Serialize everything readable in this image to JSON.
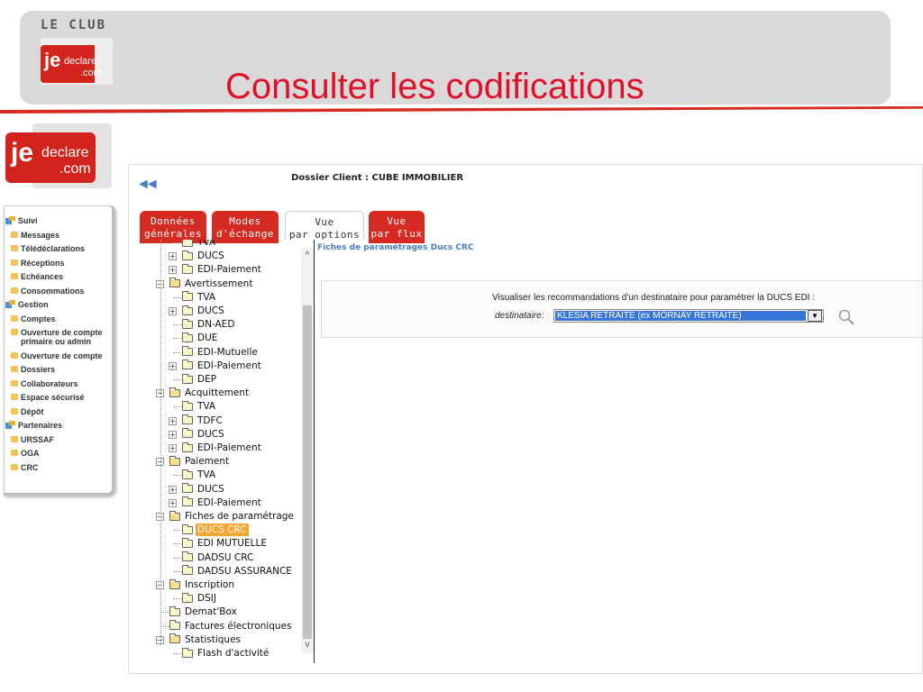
{
  "banner": {
    "club_label": "LE CLUB",
    "logo_je": "je",
    "logo_declare": "declare",
    "logo_com": ".com",
    "title": "Consulter les codifications"
  },
  "side_logo": {
    "je": "je",
    "declare": "declare",
    "com": ".com"
  },
  "menu": {
    "items": [
      {
        "label": "Suivi",
        "type": "head"
      },
      {
        "label": "Messages",
        "type": "sub"
      },
      {
        "label": "Télédéclarations",
        "type": "sub"
      },
      {
        "label": "Réceptions",
        "type": "sub"
      },
      {
        "label": "Echéances",
        "type": "sub"
      },
      {
        "label": "Consommations",
        "type": "sub"
      },
      {
        "label": "Gestion",
        "type": "head"
      },
      {
        "label": "Comptes",
        "type": "sub"
      },
      {
        "label": "Ouverture de compte",
        "label2": "primaire ou admin",
        "type": "sub"
      },
      {
        "label": "Ouverture de compte",
        "type": "sub"
      },
      {
        "label": "Dossiers",
        "type": "sub"
      },
      {
        "label": "Collaborateurs",
        "type": "sub"
      },
      {
        "label": "Espace sécurisé",
        "type": "sub"
      },
      {
        "label": "Dépôt",
        "type": "sub"
      },
      {
        "label": "Partenaires",
        "type": "head"
      },
      {
        "label": "URSSAF",
        "type": "sub"
      },
      {
        "label": "OGA",
        "type": "sub"
      },
      {
        "label": "CRC",
        "type": "sub"
      }
    ]
  },
  "header": {
    "back_arrow": "◄◄",
    "dossier": "Dossier Client : CUBE IMMOBILIER"
  },
  "tabs": [
    {
      "line1": "Données",
      "line2": "générales",
      "style": "red"
    },
    {
      "line1": "Modes",
      "line2": "d'échange",
      "style": "red"
    },
    {
      "line1": "Vue",
      "line2": "par options",
      "style": "white"
    },
    {
      "line1": "Vue",
      "line2": "par flux",
      "style": "red"
    }
  ],
  "tree": {
    "nodes": [
      {
        "label": "TVA",
        "level": 2,
        "pm": ""
      },
      {
        "label": "DUCS",
        "level": 2,
        "pm": "+"
      },
      {
        "label": "EDI-Paiement",
        "level": 2,
        "pm": "+"
      },
      {
        "label": "Avertissement",
        "level": 1,
        "pm": "−"
      },
      {
        "label": "TVA",
        "level": 2,
        "pm": ""
      },
      {
        "label": "DUCS",
        "level": 2,
        "pm": "+"
      },
      {
        "label": "DN-AED",
        "level": 2,
        "pm": ""
      },
      {
        "label": "DUE",
        "level": 2,
        "pm": ""
      },
      {
        "label": "EDI-Mutuelle",
        "level": 2,
        "pm": ""
      },
      {
        "label": "EDI-Paiement",
        "level": 2,
        "pm": "+"
      },
      {
        "label": "DEP",
        "level": 2,
        "pm": ""
      },
      {
        "label": "Acquittement",
        "level": 1,
        "pm": "−"
      },
      {
        "label": "TVA",
        "level": 2,
        "pm": ""
      },
      {
        "label": "TDFC",
        "level": 2,
        "pm": "+"
      },
      {
        "label": "DUCS",
        "level": 2,
        "pm": "+"
      },
      {
        "label": "EDI-Paiement",
        "level": 2,
        "pm": "+"
      },
      {
        "label": "Paiement",
        "level": 1,
        "pm": "−"
      },
      {
        "label": "TVA",
        "level": 2,
        "pm": ""
      },
      {
        "label": "DUCS",
        "level": 2,
        "pm": "+"
      },
      {
        "label": "EDI-Paiement",
        "level": 2,
        "pm": "+"
      },
      {
        "label": "Fiches de paramétrage",
        "level": 1,
        "pm": "−"
      },
      {
        "label": "DUCS CRC",
        "level": 2,
        "pm": "",
        "selected": true
      },
      {
        "label": "EDI MUTUELLE",
        "level": 2,
        "pm": ""
      },
      {
        "label": "DADSU CRC",
        "level": 2,
        "pm": ""
      },
      {
        "label": "DADSU ASSURANCE",
        "level": 2,
        "pm": ""
      },
      {
        "label": "Inscription",
        "level": 1,
        "pm": "−"
      },
      {
        "label": "DSIJ",
        "level": 2,
        "pm": ""
      },
      {
        "label": "Demat'Box",
        "level": 1,
        "pm": ""
      },
      {
        "label": "Factures électroniques",
        "level": 1,
        "pm": ""
      },
      {
        "label": "Statistiques",
        "level": 1,
        "pm": "−"
      },
      {
        "label": "Flash d'activité",
        "level": 2,
        "pm": ""
      }
    ]
  },
  "content": {
    "section_title": "Fiches de paramétrages Ducs CRC",
    "instruction": "Visualiser les recommandations d'un destinataire pour paramétrer la DUCS EDI :",
    "destinataire_label": "destinataire:",
    "destinataire_value": "KLESIA RETRAITE (ex MORNAY RETRAITE)"
  },
  "colors": {
    "brand_red": "#d52b22",
    "title_red": "#e0102a",
    "selected_orange": "#f8a532",
    "link_blue": "#4a7cc0"
  }
}
